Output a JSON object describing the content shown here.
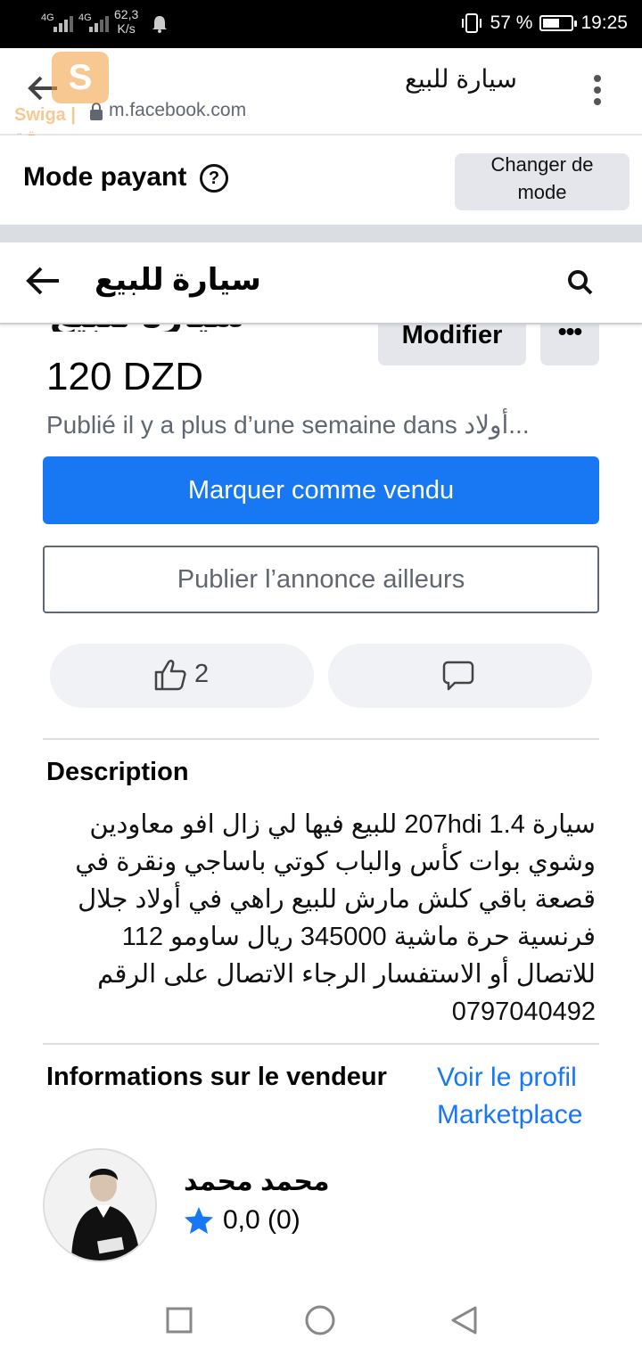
{
  "status_bar": {
    "signal_1": "4G",
    "signal_2": "4G",
    "net_speed": "62,3",
    "net_unit": "K/s",
    "battery": "57 %",
    "battery_level": 0.57,
    "time": "19:25"
  },
  "browser": {
    "title": "سيارة للبيع",
    "url": "m.facebook.com",
    "watermark": "Swiga | سويقة"
  },
  "mode": {
    "label": "Mode payant",
    "change_line1": "Changer de",
    "change_line2": "mode"
  },
  "header": {
    "title": "سيارة للبيع"
  },
  "listing": {
    "title": "سيارة للبيع",
    "modify_label": "Modifier",
    "more_label": "•••",
    "price": "120 DZD",
    "published": "Publié il y a plus d’une semaine dans أولاد...",
    "mark_sold_label": "Marquer comme vendu",
    "publish_elsewhere_label": "Publier l’annonce ailleurs",
    "like_count": "2"
  },
  "description": {
    "heading": "Description",
    "body": "سيارة 1.4 207hdi للبيع فيها لي زال افو معاودين وشوي بوات كأس والباب كوتي باساجي ونقرة في قصعة  باقي كلش مارش للبيع راهي في أولاد جلال فرنسية حرة  ماشية 345000 ريال ساومو 112 للاتصال أو الاستفسار الرجاء الاتصال على الرقم  0797040492"
  },
  "seller": {
    "heading": "Informations sur le vendeur",
    "profile_link": "Voir le profil Marketplace",
    "name": "محمد محمد",
    "rating": "0,0 (0)"
  },
  "colors": {
    "primary": "#1877f2",
    "gray_button": "#e4e6eb",
    "secondary_text": "#606770"
  }
}
